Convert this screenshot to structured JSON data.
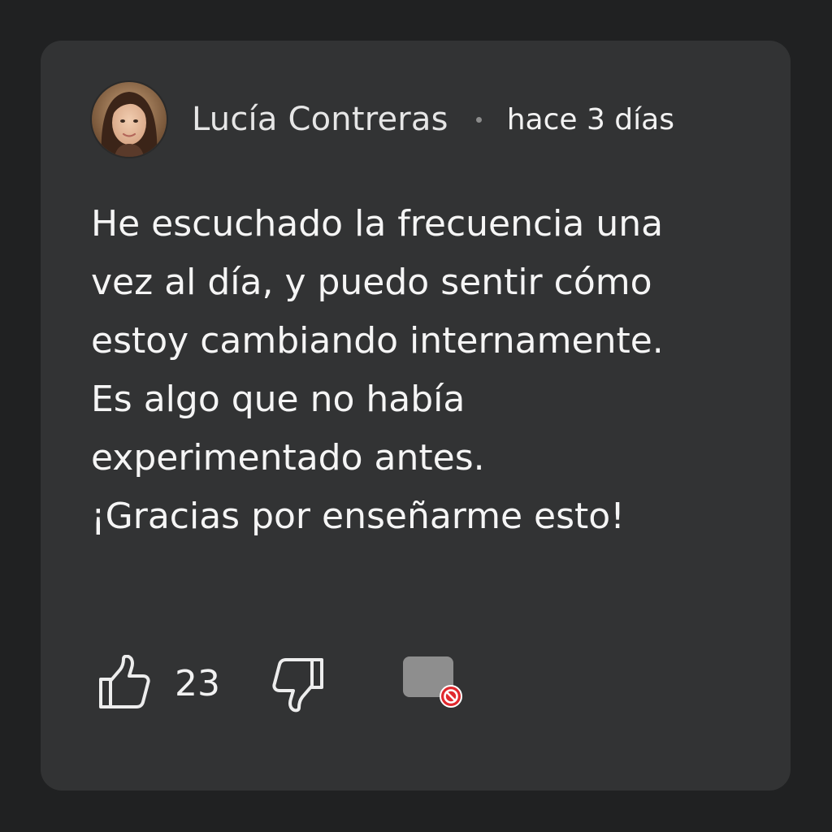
{
  "comment": {
    "author": "Lucía Contreras",
    "separator": "•",
    "timestamp": "hace 3 días",
    "body_lines": [
      "He escuchado la frecuencia una",
      "vez al día, y puedo sentir cómo",
      "estoy cambiando internamente.",
      "Es algo que no había",
      "experimentado antes.",
      "¡Gracias por enseñarme esto!"
    ]
  },
  "actions": {
    "like_count": "23",
    "like_icon": "thumbs-up-icon",
    "dislike_icon": "thumbs-down-icon",
    "reply_icon": "comment-icon",
    "reply_badge_icon": "blocked-icon"
  },
  "colors": {
    "background": "#202122",
    "card": "#323334",
    "text": "#f5f5f5",
    "badge": "#e0282e"
  }
}
